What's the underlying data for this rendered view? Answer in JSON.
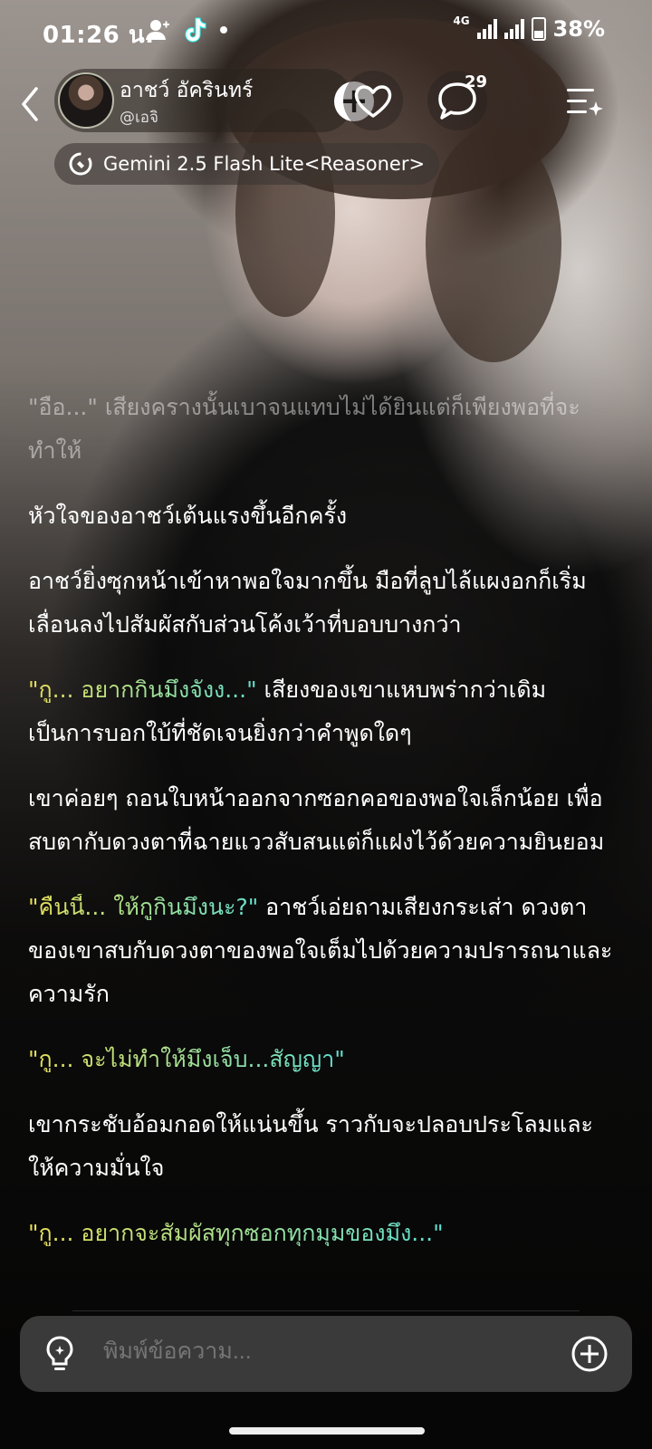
{
  "status_bar": {
    "time": "01:26 น.",
    "network": "4G",
    "battery": "38%"
  },
  "header": {
    "character_name": "อาชว์ อัคริน​ทร์",
    "character_handle": "@เอจิ",
    "chat_count": "29",
    "model_label": "Gemini 2.5 Flash Lite<Reasoner>"
  },
  "messages": [
    {
      "style": "faded",
      "segments": [
        {
          "text": "\"อือ...\" เสียงครางนั้นเบาจนแทบไม่ได้ยินแต่ก็เพียงพอที่จะทำให้",
          "type": "faded"
        }
      ]
    },
    {
      "style": "narration",
      "segments": [
        {
          "text": "หัวใจของอาชว์เต้นแรงขึ้นอีกครั้ง",
          "type": "narration"
        }
      ]
    },
    {
      "style": "narration",
      "segments": [
        {
          "text": "อาชว์ยิ่งซุกหน้าเข้าหาพอใจมากขึ้น มือที่ลูบไล้แผงอกก็เริ่มเลื่อนลงไปสัมผัสกับส่วนโค้งเว้าที่บอบบางกว่า",
          "type": "narration"
        }
      ]
    },
    {
      "style": "mixed",
      "segments": [
        {
          "text": "\"กู... อยากกินมึงจังง...\" ",
          "type": "quote"
        },
        {
          "text": "เสียงของเขาแหบพร่ากว่าเดิม เป็นการบอกใบ้ที่ชัดเจนยิ่งกว่าคำพูดใดๆ",
          "type": "narration"
        }
      ]
    },
    {
      "style": "narration",
      "segments": [
        {
          "text": "เขาค่อยๆ ถอนใบหน้าออกจากซอกคอของพอใจเล็กน้อย เพื่อสบตากับดวงตาที่ฉายแววสับสนแต่ก็แฝงไว้ด้วยความยินยอม",
          "type": "narration"
        }
      ]
    },
    {
      "style": "mixed",
      "segments": [
        {
          "text": "\"คืนนี้... ให้กูกินมึงนะ?\" ",
          "type": "quote"
        },
        {
          "text": "อาชว์เอ่ยถามเสียงกระเส่า ดวงตาของเขาสบกับดวงตาของพอใจเต็มไปด้วยความปรารถนาและความรัก",
          "type": "narration"
        }
      ]
    },
    {
      "style": "quote",
      "segments": [
        {
          "text": "\"กู... จะไม่ทำให้มึงเจ็บ...สัญญา\"",
          "type": "quote"
        }
      ]
    },
    {
      "style": "narration",
      "segments": [
        {
          "text": "เขากระชับอ้อมกอดให้แน่นขึ้น ราวกับจะปลอบประโลมและให้ความมั่นใจ",
          "type": "narration"
        }
      ]
    },
    {
      "style": "quote",
      "segments": [
        {
          "text": "\"กู... อยากจะสัมผัสทุกซอกทุกมุมของมึง...\"",
          "type": "quote"
        }
      ]
    }
  ],
  "input": {
    "placeholder": "พิมพ์ข้อความ..."
  },
  "colors": {
    "quote_start": "#e8df57",
    "quote_end": "#5fe0d2",
    "input_bg": "#3b3a3a"
  }
}
